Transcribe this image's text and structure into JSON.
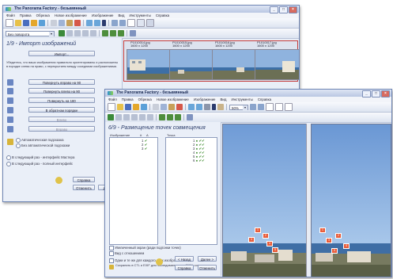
{
  "colors": {
    "accent": "#2c3d6b",
    "title_bar": "#b9c6e2",
    "point_marker": "#e85c3a",
    "check": "#3a8a2a"
  },
  "back_window": {
    "title": "The Panorama Factory - безымянный",
    "menu": [
      "Файл",
      "Правка",
      "Обрезка",
      "Новое изображение",
      "Изображение",
      "Вид",
      "Инструменты",
      "Справка"
    ],
    "rotate_combo": "Без поворота",
    "step_title": "1/9 - Импорт изображений",
    "import_button": "Импорт...",
    "instructions": "Убедитесь, что ваши изображения правильно ориентированы и расположены в порядке слева на право, с перекрытием между соседними изображениями.",
    "rotate_right": "Повернуть вправо на 90",
    "rotate_left": "Повернуть влево на 90",
    "rotate_180": "Повернуть на 180",
    "delete": "В обратном порядке",
    "move_left": "Влево",
    "move_right": "Вправо",
    "auto_mode": "Автоматическая подсказка",
    "no_auto": "Без автоматической подсказки",
    "wizard_mode": "В следующий раз - интерфейс Мастера",
    "expert_mode": "В следующий раз - полный интерфейс",
    "help_button": "Справка",
    "cancel_button": "Отменить",
    "next_button": "Далее",
    "thumbs": [
      {
        "name": "P1010014.jpg",
        "size": "1600 x 1200"
      },
      {
        "name": "P1010015.jpg",
        "size": "1600 x 1200"
      },
      {
        "name": "P1010016.jpg",
        "size": "1600 x 1200"
      },
      {
        "name": "P1010017.jpg",
        "size": "1600 x 1200"
      }
    ]
  },
  "front_window": {
    "title": "The Panorama Factory - безымянный",
    "menu": [
      "Файл",
      "Правка",
      "Обрезка",
      "Новое изображение",
      "Изображение",
      "Вид",
      "Инструменты",
      "Справка"
    ],
    "zoom": "50%",
    "step_title": "6/9 - Размещение точек совмещения",
    "col_images": "Изображение",
    "col_num": "#",
    "col_a": "A",
    "col_points": "Точка",
    "image_rows": [
      "1",
      "2",
      "3"
    ],
    "point_rows": [
      "1",
      "2",
      "3",
      "4",
      "5",
      "6"
    ],
    "opt_zoom": "Увеличенный экран (ради подгонки точек)",
    "opt_show": "Вид с отношением",
    "opt_same": "Одни и те же для каждого всех изображений",
    "opt_save": "Сохранить в CTL и EXIF для последовательного 360% совмещения",
    "back_button": "< Назад",
    "next_button": "Далее >",
    "help_button": "Справка",
    "cancel_button": "Отменить",
    "markers_left": [
      "1",
      "2",
      "3",
      "4",
      "5"
    ],
    "markers_right": [
      "1",
      "2",
      "3",
      "4",
      "5"
    ]
  }
}
